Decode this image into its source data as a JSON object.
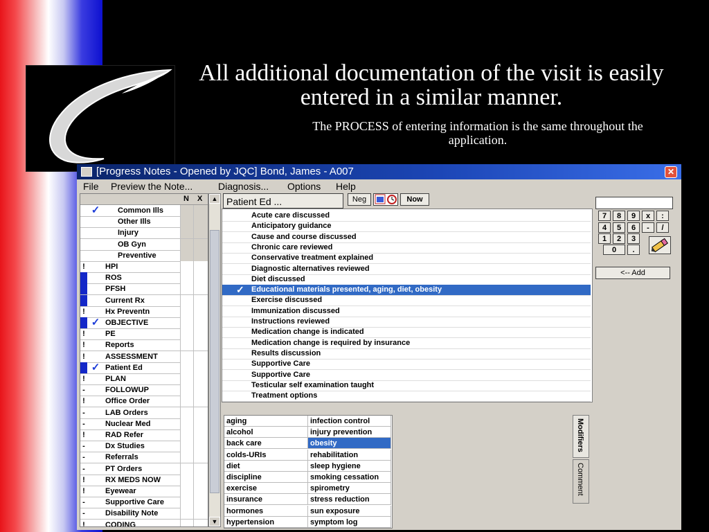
{
  "slide": {
    "title": "All additional documentation of the visit is easily entered in a similar manner.",
    "subtitle": "The PROCESS of entering information is the same throughout the application."
  },
  "window": {
    "title": "[Progress Notes - Opened by JQC] Bond, James - A007",
    "close_label": "✕"
  },
  "menu": [
    "File",
    "Preview the Note...",
    "Diagnosis...",
    "Options",
    "Help"
  ],
  "nav": {
    "header_n": "N",
    "header_x": "X",
    "items": [
      {
        "marker": "",
        "checked": true,
        "label": "Common Ills",
        "sub": true,
        "grey": true
      },
      {
        "marker": "",
        "checked": false,
        "label": "Other Ills",
        "sub": true,
        "grey": true
      },
      {
        "marker": "",
        "checked": false,
        "label": "Injury",
        "sub": true,
        "grey": true
      },
      {
        "marker": "",
        "checked": false,
        "label": "OB Gyn",
        "sub": true,
        "grey": true
      },
      {
        "marker": "",
        "checked": false,
        "label": "Preventive",
        "sub": true,
        "grey": true
      },
      {
        "marker": "!",
        "checked": false,
        "label": "HPI"
      },
      {
        "marker": "blue",
        "checked": false,
        "label": "ROS"
      },
      {
        "marker": "blue",
        "checked": false,
        "label": "PFSH"
      },
      {
        "marker": "blue",
        "checked": false,
        "label": "Current Rx"
      },
      {
        "marker": "!",
        "checked": false,
        "label": "Hx Preventn"
      },
      {
        "marker": "blue",
        "checked": true,
        "label": "OBJECTIVE"
      },
      {
        "marker": "!",
        "checked": false,
        "label": "PE"
      },
      {
        "marker": "!",
        "checked": false,
        "label": "Reports"
      },
      {
        "marker": "!",
        "checked": false,
        "label": "ASSESSMENT"
      },
      {
        "marker": "blue",
        "checked": true,
        "label": "Patient Ed"
      },
      {
        "marker": "!",
        "checked": false,
        "label": "PLAN"
      },
      {
        "marker": "-",
        "checked": false,
        "label": "FOLLOWUP"
      },
      {
        "marker": "!",
        "checked": false,
        "label": "Office Order"
      },
      {
        "marker": "-",
        "checked": false,
        "label": "LAB Orders"
      },
      {
        "marker": "-",
        "checked": false,
        "label": "Nuclear Med"
      },
      {
        "marker": "!",
        "checked": false,
        "label": "RAD Refer"
      },
      {
        "marker": "-",
        "checked": false,
        "label": "Dx Studies"
      },
      {
        "marker": "-",
        "checked": false,
        "label": "Referrals"
      },
      {
        "marker": "-",
        "checked": false,
        "label": "PT Orders"
      },
      {
        "marker": "!",
        "checked": false,
        "label": "RX MEDS NOW"
      },
      {
        "marker": "!",
        "checked": false,
        "label": "Eyewear"
      },
      {
        "marker": "-",
        "checked": false,
        "label": "Supportive Care"
      },
      {
        "marker": "-",
        "checked": false,
        "label": "Disability Note"
      },
      {
        "marker": "!",
        "checked": false,
        "label": "CODING"
      }
    ]
  },
  "section_button": "Patient Ed ...",
  "toolbar": {
    "neg": "Neg",
    "now": "Now"
  },
  "items": [
    {
      "label": "Acute care discussed"
    },
    {
      "label": "Anticipatory guidance"
    },
    {
      "label": "Cause and course discussed"
    },
    {
      "label": "Chronic care reviewed"
    },
    {
      "label": "Conservative treatment explained"
    },
    {
      "label": "Diagnostic alternatives reviewed"
    },
    {
      "label": "Diet discussed"
    },
    {
      "label": "Educational materials presented, aging, diet, obesity",
      "selected": true
    },
    {
      "label": "Exercise discussed"
    },
    {
      "label": "Immunization discussed"
    },
    {
      "label": "Instructions reviewed"
    },
    {
      "label": "Medication change is indicated"
    },
    {
      "label": "Medication change is required by insurance"
    },
    {
      "label": "Results discussion"
    },
    {
      "label": "Supportive Care"
    },
    {
      "label": "Supportive Care"
    },
    {
      "label": "Testicular self examination taught"
    },
    {
      "label": "Treatment options"
    }
  ],
  "modifiers": {
    "col1": [
      "aging",
      "alcohol",
      "back care",
      "colds-URIs",
      "diet",
      "discipline",
      "exercise",
      "insurance",
      "hormones",
      "hypertension"
    ],
    "col2": [
      "infection control",
      "injury prevention",
      "obesity",
      "rehabilitation",
      "sleep hygiene",
      "smoking cessation",
      "spirometry",
      "stress reduction",
      "sun exposure",
      "symptom log"
    ],
    "selected_col2": 2
  },
  "tabs": {
    "modifiers": "Modifiers",
    "comment": "Comment"
  },
  "keypad": {
    "keys": [
      "7",
      "8",
      "9",
      "x",
      ":",
      "4",
      "5",
      "6",
      "-",
      "/",
      "1",
      "2",
      "3",
      "0",
      "."
    ],
    "add_label": "<-- Add"
  }
}
